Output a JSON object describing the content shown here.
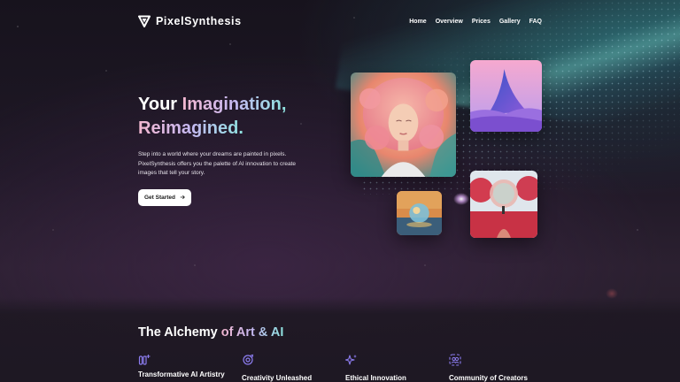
{
  "brand": {
    "name": "PixelSynthesis",
    "icon": "logo-icon"
  },
  "nav": [
    "Home",
    "Overview",
    "Prices",
    "Gallery",
    "FAQ"
  ],
  "hero": {
    "title_plain": "Your ",
    "title_highlight_1": "Imagination,",
    "title_highlight_2": "Reimagined.",
    "description": "Step into a world where your dreams are painted in pixels. PixelSynthesis offers you the palette of AI innovation to create images that tell your story.",
    "cta_label": "Get Started",
    "cta_icon": "arrow-right-icon"
  },
  "gallery": {
    "images": [
      "portrait-pink-hair",
      "abstract-purple-mountain",
      "crystal-sphere-lake",
      "red-trees-figure"
    ]
  },
  "section": {
    "title_plain": "The Alchemy ",
    "title_highlight": "of Art & AI",
    "features": [
      {
        "label": "Transformative AI Artistry",
        "icon": "pen-sparkle-icon"
      },
      {
        "label": "Creativity Unleashed",
        "icon": "target-icon"
      },
      {
        "label": "Ethical Innovation",
        "icon": "sparkles-icon"
      },
      {
        "label": "Community of Creators",
        "icon": "users-icon"
      }
    ]
  },
  "colors": {
    "accent_pink": "#f3b7d0",
    "accent_violet": "#c6b9f2",
    "accent_teal": "#8ee3e0",
    "icon_purple": "#8c7cf0"
  }
}
